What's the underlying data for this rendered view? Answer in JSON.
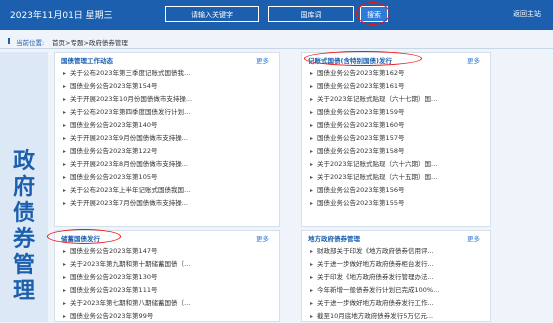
{
  "header": {
    "date": "2023年11月01日 星期三",
    "search_placeholder": "请输入关键字",
    "database": "国库词",
    "search_label": "搜索",
    "home_link": "返回主站"
  },
  "breadcrumb": {
    "label": "当前位置:",
    "path": "首页>专题>政府债券管理"
  },
  "sidebar": {
    "title": "政府债券管理"
  },
  "panels": {
    "debt_mgmt": {
      "title": "国债管理工作动态",
      "more": "更多",
      "items": [
        "关于公布2023年第三季度记账式国债我...",
        "国债业务公告2023年第154号",
        "关于开展2023年10月份国债做市支持操...",
        "关于公布2023年第四季度国债发行计划...",
        "国债业务公告2023年第140号",
        "关于开展2023年9月份国债做市支持操...",
        "国债业务公告2023年第122号",
        "关于开展2023年8月份国债做市支持操...",
        "国债业务公告2023年第105号",
        "关于公布2023年上半年记账式国债我国...",
        "关于开展2023年7月份国债做市支持操..."
      ]
    },
    "book_entry": {
      "title": "记账式国债(含特别国债)发行",
      "more": "更多",
      "items": [
        "国债业务公告2023年第162号",
        "国债业务公告2023年第161号",
        "关于2023年记账式贴现（六十七期）国...",
        "国债业务公告2023年第159号",
        "国债业务公告2023年第160号",
        "国债业务公告2023年第157号",
        "国债业务公告2023年第158号",
        "关于2023年记账式贴现（六十六期）国...",
        "关于2023年记账式贴现（六十五期）国...",
        "国债业务公告2023年第156号",
        "国债业务公告2023年第155号"
      ]
    },
    "savings": {
      "title": "储蓄国债发行",
      "more": "更多",
      "items": [
        "国债业务公告2023年第147号",
        "关于2023年第九期和第十期储蓄国债（...",
        "国债业务公告2023年第130号",
        "国债业务公告2023年第111号",
        "关于2023年第七期和第八期储蓄国债（...",
        "国债业务公告2023年第99号"
      ]
    },
    "local_gov": {
      "title": "地方政府债券管理",
      "more": "更多",
      "items": [
        "财政部关于印发《地方政府债券信用评...",
        "关于进一步做好地方政府债券柜台发行...",
        "关于印发《地方政府债券发行管理办法...",
        "今年新增一般债券发行计划已完成100%...",
        "关于进一步做好地方政府债券发行工作...",
        "截至10月底地方政府债券发行5万亿元..."
      ]
    }
  }
}
